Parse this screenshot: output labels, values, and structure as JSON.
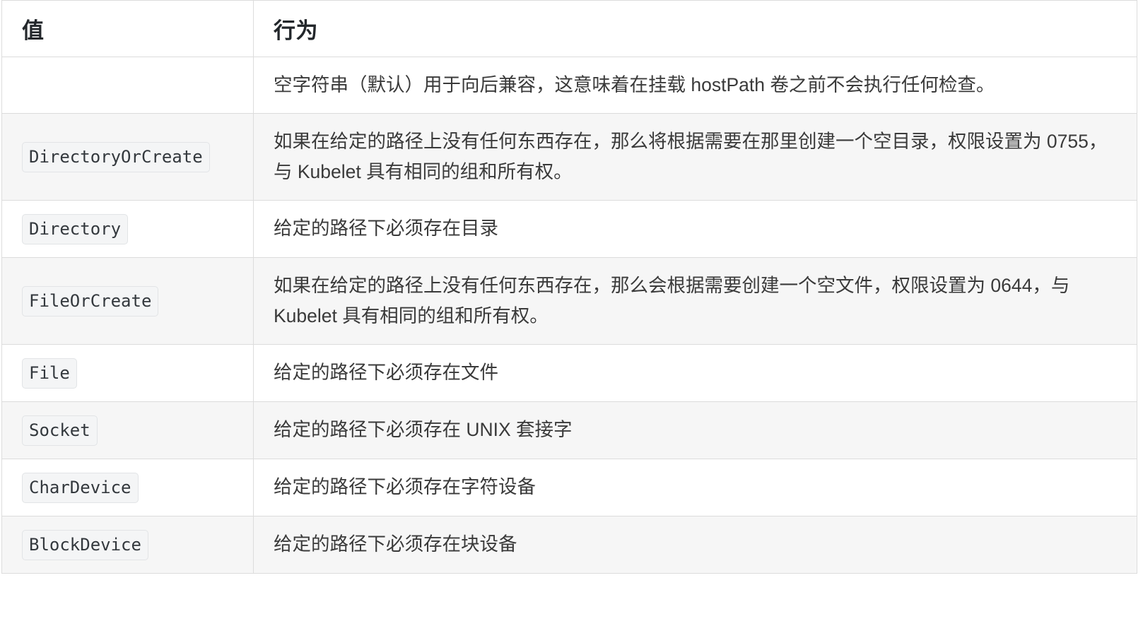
{
  "table": {
    "columns": [
      {
        "key": "value",
        "header": "值"
      },
      {
        "key": "behavior",
        "header": "行为"
      }
    ],
    "rows": [
      {
        "value": "",
        "value_is_code": false,
        "behavior": "空字符串（默认）用于向后兼容，这意味着在挂载 hostPath 卷之前不会执行任何检查。"
      },
      {
        "value": "DirectoryOrCreate",
        "value_is_code": true,
        "behavior": "如果在给定的路径上没有任何东西存在，那么将根据需要在那里创建一个空目录，权限设置为 0755，与 Kubelet 具有相同的组和所有权。"
      },
      {
        "value": "Directory",
        "value_is_code": true,
        "behavior": "给定的路径下必须存在目录"
      },
      {
        "value": "FileOrCreate",
        "value_is_code": true,
        "behavior": "如果在给定的路径上没有任何东西存在，那么会根据需要创建一个空文件，权限设置为 0644，与 Kubelet 具有相同的组和所有权。"
      },
      {
        "value": "File",
        "value_is_code": true,
        "behavior": "给定的路径下必须存在文件"
      },
      {
        "value": "Socket",
        "value_is_code": true,
        "behavior": "给定的路径下必须存在 UNIX 套接字"
      },
      {
        "value": "CharDevice",
        "value_is_code": true,
        "behavior": "给定的路径下必须存在字符设备"
      },
      {
        "value": "BlockDevice",
        "value_is_code": true,
        "behavior": "给定的路径下必须存在块设备"
      }
    ]
  },
  "colors": {
    "border": "#dcdcdc",
    "stripe": "#f6f6f6",
    "header_text": "#23272b",
    "body_text": "#3a3a3a",
    "code_bg": "#f4f5f6",
    "code_border": "#e2e4e6"
  }
}
